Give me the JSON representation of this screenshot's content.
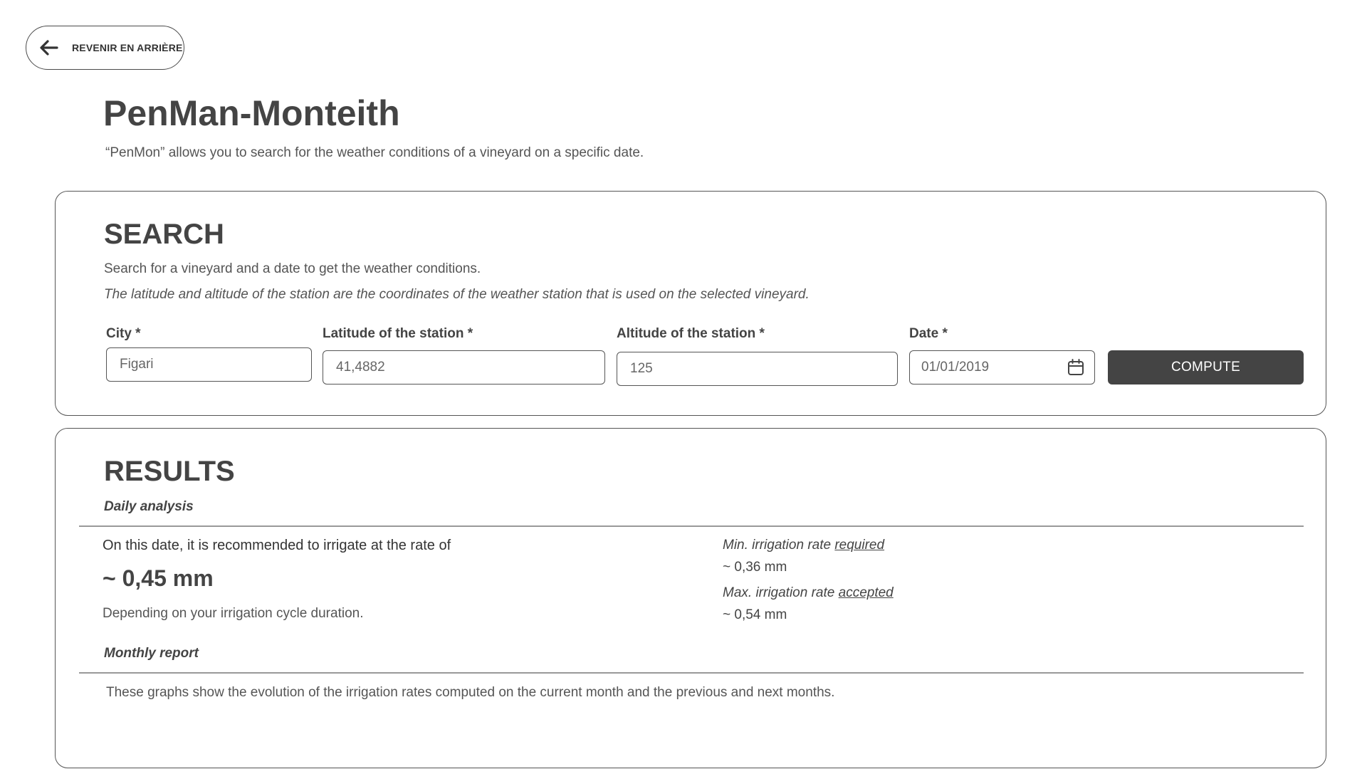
{
  "back_button": {
    "label": "REVENIR EN ARRIÈRE"
  },
  "header": {
    "title": "PenMan-Monteith",
    "subtitle": "“PenMon” allows you to search for the weather conditions of a vineyard on a specific date."
  },
  "search": {
    "title": "SEARCH",
    "description": "Search for a vineyard and a date to get the weather conditions.",
    "note": "The latitude and altitude of the station are the coordinates of the weather station that is used on the selected vineyard.",
    "fields": {
      "city": {
        "label": "City *",
        "value": "Figari"
      },
      "latitude": {
        "label": "Latitude of the station *",
        "value": "41,4882"
      },
      "altitude": {
        "label": "Altitude of the station *",
        "value": "125"
      },
      "date": {
        "label": "Date *",
        "value": "01/01/2019",
        "icon": "calendar-icon"
      }
    },
    "compute_label": "COMPUTE"
  },
  "results": {
    "title": "RESULTS",
    "daily": {
      "heading": "Daily analysis",
      "recommendation": "On this date, it is recommended to irrigate at the rate of",
      "rate": "~ 0,45 mm",
      "note": "Depending on your irrigation cycle duration.",
      "min_label_prefix": "Min. irrigation rate ",
      "min_label_emphasis": "required",
      "min_value": "~ 0,36 mm",
      "max_label_prefix": "Max. irrigation rate ",
      "max_label_emphasis": "accepted",
      "max_value": "~ 0,54 mm"
    },
    "monthly": {
      "heading": "Monthly report",
      "description": "These graphs show the evolution of the irrigation rates computed on the current month and the previous and next months."
    }
  }
}
